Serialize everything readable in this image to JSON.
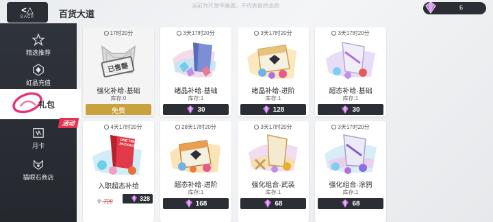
{
  "header": {
    "back_label": "BACK",
    "title": "百货大道",
    "notice": "当前为开发中画面，不代表最终品质",
    "currency_amount": "6"
  },
  "sidebar": {
    "items": [
      {
        "label": "精选推荐",
        "icon": "star-icon"
      },
      {
        "label": "虹晶充值",
        "icon": "crystal-icon"
      },
      {
        "label": "礼包",
        "icon": "gift-icon"
      },
      {
        "label": "月卡",
        "icon": "month-card-icon"
      },
      {
        "label": "猫眼石商店",
        "icon": "catseye-shop-icon"
      }
    ],
    "event_badge": "活动"
  },
  "cards": [
    {
      "timer": "17时20分",
      "name": "强化补给·基础",
      "stock": "库存:0",
      "price": "免费",
      "stamp": "已售罄"
    },
    {
      "timer": "3天17时20分",
      "name": "绪晶补给·基础",
      "stock": "库存:1",
      "price": "30"
    },
    {
      "timer": "3天17时20分",
      "name": "绪晶补给·进阶",
      "stock": "库存:1",
      "price": "128"
    },
    {
      "timer": "3天17时20分",
      "name": "超态补给·基础",
      "stock": "库存:1",
      "price": "30"
    },
    {
      "timer": "4天17时20分",
      "name": "入职超态补给",
      "stock": "",
      "price": "328",
      "orig_price": "728",
      "box_text": "ONE TIME PACKAGE"
    },
    {
      "timer": "28天17时20分",
      "name": "超态补给·进阶",
      "stock": "库存:1",
      "price": "168"
    },
    {
      "timer": "3天17时20分",
      "name": "强化组合·武装",
      "stock": "库存:1",
      "price": "68"
    },
    {
      "timer": "3天17时20分",
      "name": "强化组合·涂鸦",
      "stock": "库存:1",
      "price": "68"
    }
  ],
  "colors": {
    "sidebar_bg": "#2b2e35",
    "accent_pink": "#e6334f",
    "free_gold": "#c9a23e",
    "gem_purple": "#b56ad8"
  }
}
